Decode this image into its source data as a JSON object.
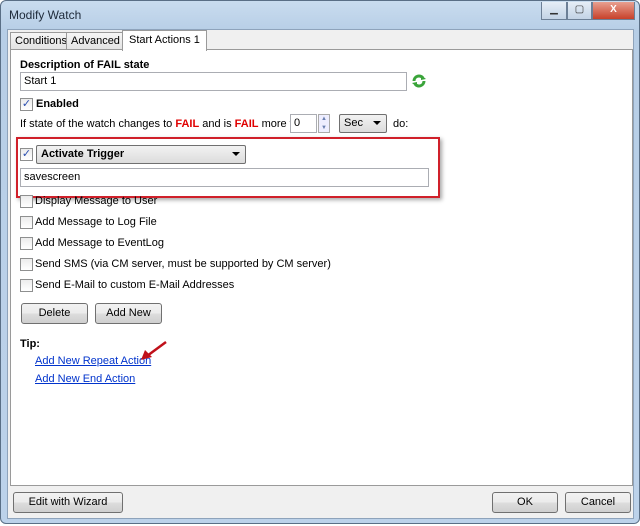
{
  "window": {
    "title": "Modify Watch",
    "minimize_icon": "minimize-icon",
    "maximize_icon": "maximize-icon",
    "close_icon": "close-icon"
  },
  "tabs": [
    {
      "label": "Conditions",
      "active": false
    },
    {
      "label": "Advanced",
      "active": false
    },
    {
      "label": "Start Actions 1",
      "active": true
    }
  ],
  "form": {
    "description_label": "Description of FAIL state",
    "description_value": "Start 1",
    "enabled_label": "Enabled",
    "enabled_checked": true,
    "condition": {
      "prefix": "If state of the watch changes to",
      "fail1": "FAIL",
      "middle": "and is",
      "fail2": "FAIL",
      "suffix": "more than",
      "duration": "0",
      "unit": "Sec",
      "do": "do:"
    },
    "action": {
      "checked": true,
      "type": "Activate Trigger",
      "value": "savescreen"
    },
    "options": [
      {
        "label": "Display Message to User",
        "checked": false
      },
      {
        "label": "Add Message to Log File",
        "checked": false
      },
      {
        "label": "Add Message to EventLog",
        "checked": false
      },
      {
        "label": "Send SMS (via CM server, must be supported by CM server)",
        "checked": false
      },
      {
        "label": "Send E-Mail to custom E-Mail Addresses",
        "checked": false
      }
    ],
    "delete_label": "Delete",
    "add_new_label": "Add New",
    "tip_label": "Tip:",
    "links": [
      "Add New Repeat Action",
      "Add New End Action"
    ]
  },
  "footer": {
    "wizard_label": "Edit with Wizard",
    "ok_label": "OK",
    "cancel_label": "Cancel"
  },
  "colors": {
    "highlight_box": "#d0202a",
    "fail_text": "#e00000",
    "link": "#0033cc"
  }
}
